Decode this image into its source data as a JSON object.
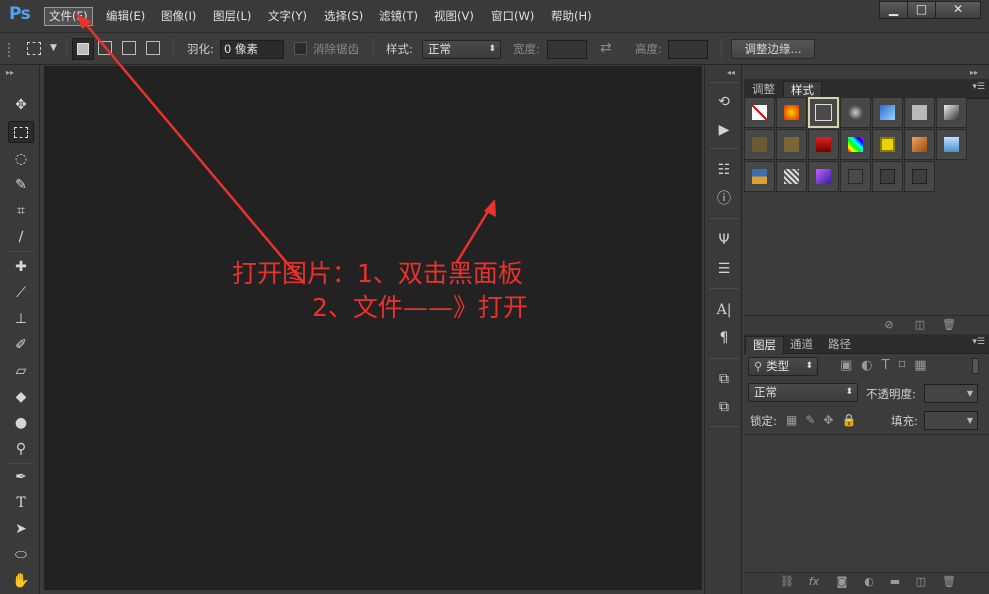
{
  "app": {
    "logo": "Ps",
    "menu": [
      {
        "label": "文件(F)",
        "active": true
      },
      {
        "label": "编辑(E)"
      },
      {
        "label": "图像(I)"
      },
      {
        "label": "图层(L)"
      },
      {
        "label": "文字(Y)"
      },
      {
        "label": "选择(S)"
      },
      {
        "label": "滤镜(T)"
      },
      {
        "label": "视图(V)"
      },
      {
        "label": "窗口(W)"
      },
      {
        "label": "帮助(H)"
      }
    ],
    "window_controls": {
      "minimize": "▁",
      "maximize": "□",
      "close": "✕"
    }
  },
  "options": {
    "feather_label": "羽化:",
    "feather_value": "0 像素",
    "antialias_label": "消除锯齿",
    "style_label": "样式:",
    "style_value": "正常",
    "width_label": "宽度:",
    "height_label": "高度:",
    "refine_edge_button": "调整边缘..."
  },
  "annotation": {
    "line1": "打开图片：1、双击黑面板",
    "line2": "2、文件——》打开",
    "color": "#e8322b"
  },
  "panels": {
    "top_tabs": [
      "调整",
      "样式"
    ],
    "top_active_tab": "样式",
    "bottom_tabs": [
      "图层",
      "通道",
      "路径"
    ],
    "bottom_active_tab": "图层",
    "filter_kind": "类型",
    "blend_mode": "正常",
    "opacity_label": "不透明度:",
    "lock_label": "锁定:",
    "fill_label": "填充:"
  },
  "icons": {
    "tools": [
      "move-icon",
      "marquee-icon",
      "lasso-icon",
      "quick-select-icon",
      "crop-icon",
      "eyedropper-icon",
      "healing-brush-icon",
      "brush-icon",
      "clone-stamp-icon",
      "history-brush-icon",
      "eraser-icon",
      "paint-bucket-icon",
      "blur-icon",
      "dodge-icon",
      "pen-icon",
      "type-icon",
      "path-select-icon",
      "ellipse-icon",
      "hand-icon"
    ]
  }
}
